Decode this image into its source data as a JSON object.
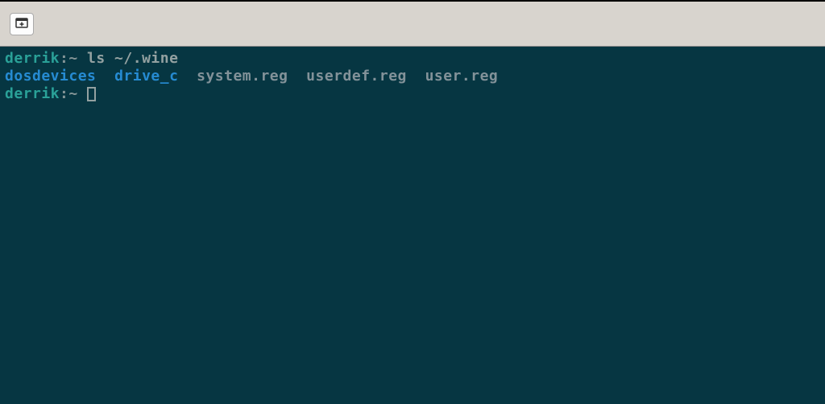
{
  "titlebar": {
    "newtab_icon": "new-tab"
  },
  "terminal": {
    "line1": {
      "prompt_user": "derrik",
      "prompt_path": ":~ ",
      "command": "ls ~/.wine"
    },
    "line2": {
      "dir1": "dosdevices",
      "gap1": "  ",
      "dir2": "drive_c",
      "gap2": "  ",
      "file1": "system.reg",
      "gap3": "  ",
      "file2": "userdef.reg",
      "gap4": "  ",
      "file3": "user.reg"
    },
    "line3": {
      "prompt_user": "derrik",
      "prompt_path": ":~ "
    }
  }
}
